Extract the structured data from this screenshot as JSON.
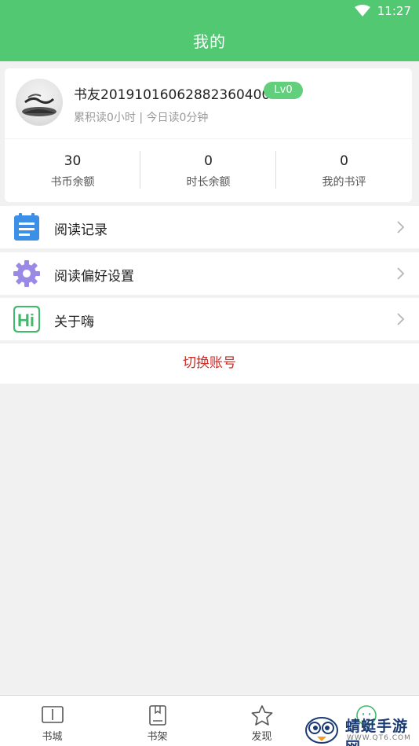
{
  "status_bar": {
    "time": "11:27"
  },
  "header": {
    "title": "我的"
  },
  "profile": {
    "username": "书友20191016062882360400",
    "level": "Lv0",
    "reading_stats": "累积读0小时 | 今日读0分钟"
  },
  "stats": [
    {
      "value": "30",
      "label": "书币余额"
    },
    {
      "value": "0",
      "label": "时长余额"
    },
    {
      "value": "0",
      "label": "我的书评"
    }
  ],
  "menu": [
    {
      "label": "阅读记录",
      "icon": "reading-record-icon"
    },
    {
      "label": "阅读偏好设置",
      "icon": "gear-icon"
    },
    {
      "label": "关于嗨",
      "icon": "hi-logo-icon"
    }
  ],
  "switch_account": "切换账号",
  "tabs": [
    {
      "label": "书城",
      "icon": "book-icon"
    },
    {
      "label": "书架",
      "icon": "bookshelf-icon"
    },
    {
      "label": "发现",
      "icon": "star-icon"
    },
    {
      "label": "",
      "icon": "smile-icon",
      "active": true
    }
  ],
  "watermark": {
    "text": "蜻蜓手游网",
    "sub": "WWW.QT6.COM"
  },
  "colors": {
    "primary": "#52c872",
    "accent_red": "#d12b25",
    "icon_blue": "#3b8fe6",
    "icon_purple": "#9b8ae5",
    "icon_green": "#3fba6a"
  }
}
